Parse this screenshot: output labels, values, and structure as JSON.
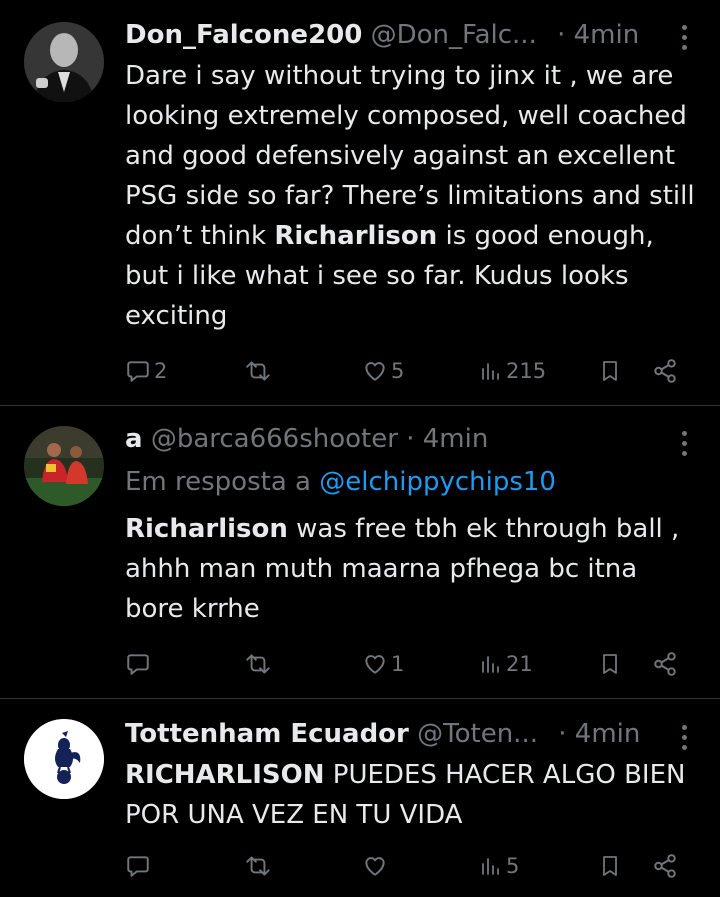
{
  "tweets": [
    {
      "name": "Don_Falcone200",
      "handle": "@Don_Falc...",
      "time": "· 4min",
      "body_pre": "Dare i say without trying to jinx it , we are looking extremely composed, well coached and good defensively against an excellent PSG side so far? There’s limitations and still don’t think ",
      "body_bold": "Richarlison",
      "body_post": " is good enough, but i like what i see so far. Kudus looks exciting",
      "replies": "2",
      "retweets": "",
      "likes": "5",
      "views": "215"
    },
    {
      "name": "a",
      "handle": "@barca666shooter",
      "time": "· 4min",
      "reply_label": "Em resposta a",
      "reply_handle": "@elchippychips10",
      "body_bold": "Richarlison",
      "body_post": " was free tbh ek through ball , ahhh man muth maarna pfhega bc itna bore krrhe",
      "replies": "",
      "retweets": "",
      "likes": "1",
      "views": "21"
    },
    {
      "name": "Tottenham Ecuador",
      "handle": "@Toten...",
      "time": "· 4min",
      "body_bold": "RICHARLISON",
      "body_post": " PUEDES HACER ALGO BIEN POR UNA VEZ EN TU VIDA",
      "replies": "",
      "retweets": "",
      "likes": "",
      "views": "5"
    }
  ],
  "icons": {
    "reply": "reply-icon",
    "retweet": "retweet-icon",
    "like": "heart-icon",
    "views": "views-icon",
    "bookmark": "bookmark-icon",
    "share": "share-icon",
    "more": "more-options-icon"
  },
  "colors": {
    "background": "#000000",
    "text": "#e7e9ea",
    "muted": "#71767b",
    "link": "#1d9bf0",
    "divider": "#2f3336"
  }
}
